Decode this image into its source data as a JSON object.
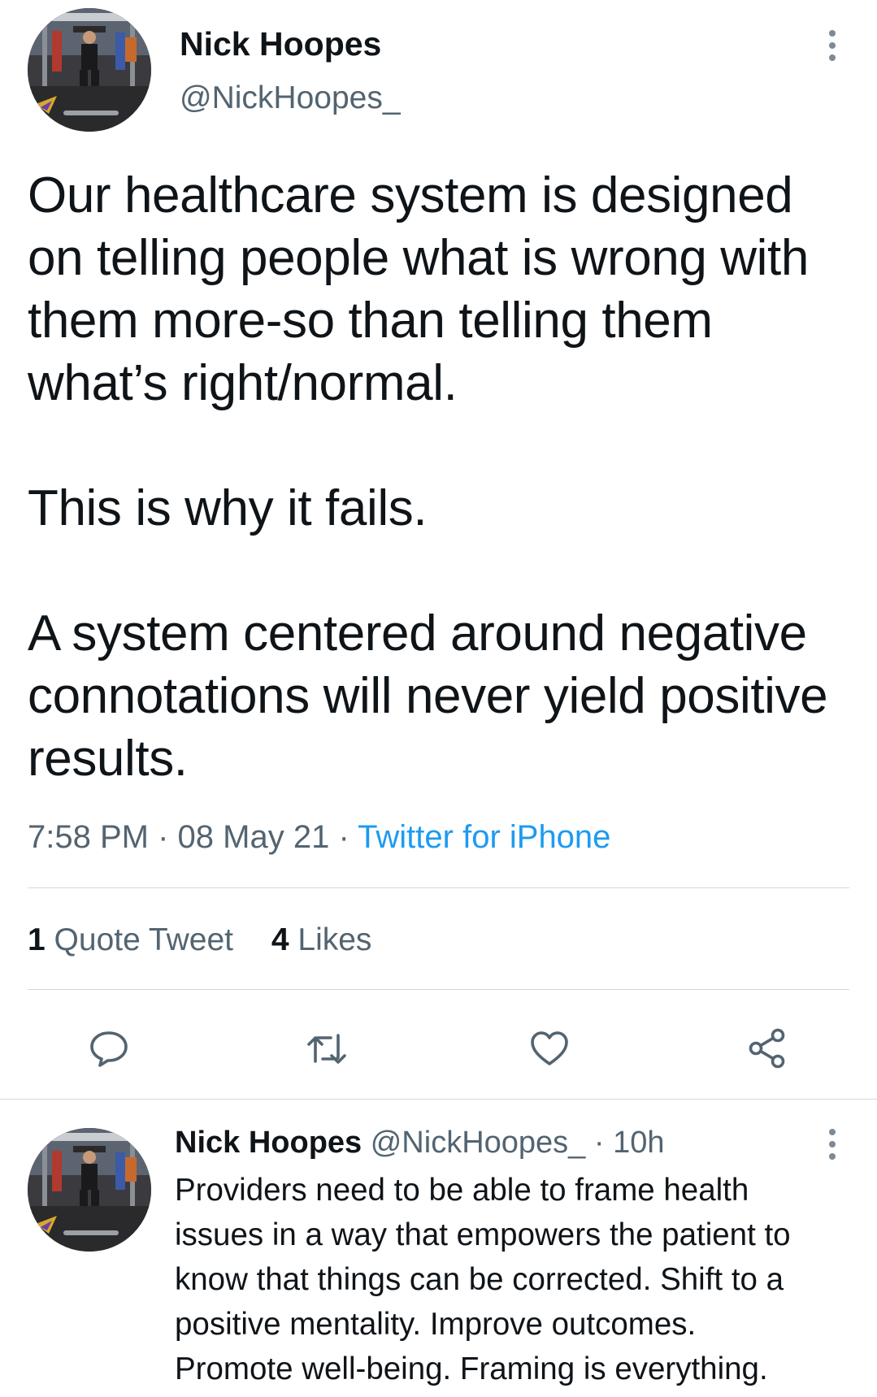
{
  "tweet": {
    "author_name": "Nick Hoopes",
    "author_handle": "@NickHoopes_",
    "text_lines": [
      "Our healthcare system is designed",
      "on telling people what is wrong with",
      "them more-so than telling them",
      "what’s right/normal.",
      "",
      "This is why it fails.",
      "",
      "A system centered around negative",
      "connotations will never yield positive",
      "results."
    ],
    "time": "7:58 PM",
    "date": "08 May 21",
    "source": "Twitter for iPhone",
    "separator": "·",
    "quote_tweets_count": "1",
    "quote_tweets_label": "Quote Tweet",
    "likes_count": "4",
    "likes_label": "Likes"
  },
  "reply": {
    "author_name": "Nick Hoopes",
    "author_handle": "@NickHoopes_",
    "separator": "·",
    "time": "10h",
    "text_lines": [
      "Providers need to be able to frame health",
      "issues in a way that empowers the patient to",
      "know that things can be corrected. Shift to a",
      "positive mentality. Improve outcomes.",
      "Promote well-being. Framing is everything."
    ]
  },
  "icons": {
    "more": "more-vertical-icon",
    "reply": "reply-icon",
    "retweet": "retweet-icon",
    "like": "heart-icon",
    "share": "share-icon"
  },
  "colors": {
    "text": "#0f1419",
    "secondary": "#536471",
    "link": "#1d9bf0",
    "divider": "#cfd9de",
    "icon": "#536471"
  }
}
